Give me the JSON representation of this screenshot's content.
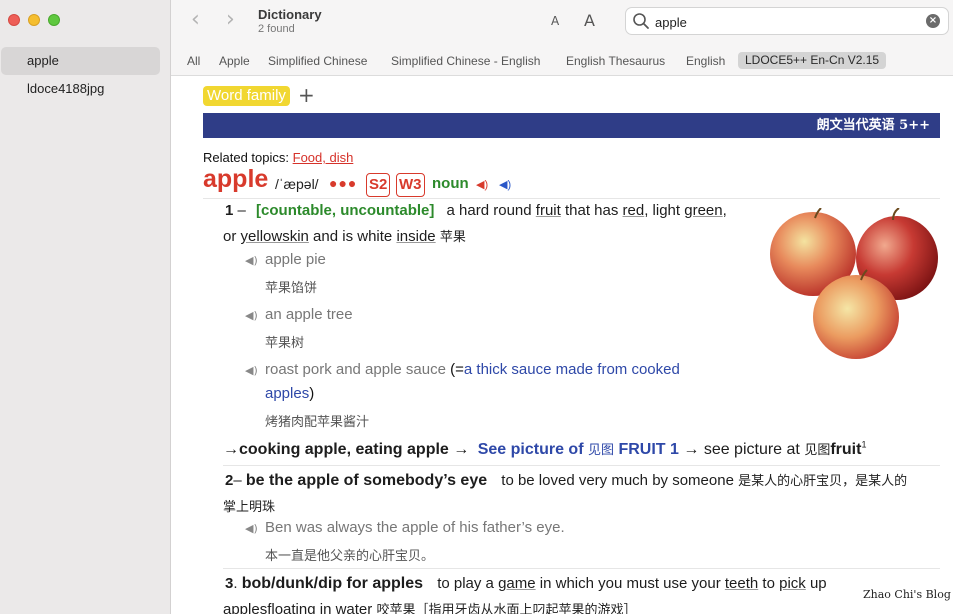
{
  "window": {
    "title": "Dictionary",
    "subtitle": "2 found"
  },
  "toolbar": {
    "font_small": "A",
    "font_large": "A"
  },
  "search": {
    "value": "apple",
    "placeholder": "Search"
  },
  "sidebar": {
    "items": [
      {
        "label": "apple",
        "selected": true
      },
      {
        "label": "ldoce4188jpg",
        "selected": false
      }
    ]
  },
  "tabs": [
    "All",
    "Apple",
    "Simplified Chinese",
    "Simplified Chinese - English",
    "English Thesaurus",
    "English",
    "LDOCE5++ En-Cn V2.15"
  ],
  "selected_tab": "LDOCE5++ En-Cn V2.15",
  "entry": {
    "word_family": "Word family",
    "plus": "+",
    "banner": "朗文当代英语 5++",
    "related_label": "Related topics:",
    "related_link": "Food, dish",
    "headword": "apple",
    "pron": "/ˈæpəl/",
    "freq_dots": "●●●",
    "badge_s": "S2",
    "badge_w": "W3",
    "pos": "noun",
    "sense1": {
      "num": "1",
      "dash": "–",
      "grammar": "[countable, uncountable]",
      "def_a": "a hard round",
      "def_fruit": "fruit",
      "def_b": "that has",
      "def_red": "red",
      "def_c": ", light",
      "def_green": "green",
      "def_d": ",",
      "def_e": "or",
      "def_yellowskin": "yellowskin",
      "def_f": "and is white",
      "def_inside": "inside",
      "cn": "苹果",
      "examples": [
        {
          "en": "apple pie",
          "cn": "苹果馅饼"
        },
        {
          "en": "an apple tree",
          "cn": "苹果树"
        },
        {
          "en": "roast pork and apple sauce",
          "paren_open": "(=",
          "gloss1": "a thick sauce made from cooked",
          "gloss2": "apples",
          "paren_close": ")",
          "cn": "烤猪肉配苹果酱汁"
        }
      ],
      "xref": {
        "arrow1": "→",
        "phrases": "cooking apple, eating apple",
        "arrow2": "→",
        "see_picture": "See picture of",
        "jian": "见图",
        "fruit_caps": "FRUIT 1",
        "arrow3": "→",
        "see_picture2": "see picture at",
        "jian2": "见图",
        "fruit": "fruit",
        "sup": "1"
      }
    },
    "sense2": {
      "num": "2",
      "dash": "–",
      "phrase": "be the apple of somebody’s eye",
      "def": "to be loved very much by someone",
      "cn_a": "是某人的心肝宝贝，是某人的",
      "cn_b": "掌上明珠",
      "example_en": "Ben was always the apple of his father’s eye.",
      "example_cn": "本一直是他父亲的心肝宝贝。"
    },
    "sense3": {
      "num": "3",
      "dot": ".",
      "phrase": "bob/dunk/dip for apples",
      "def_a": "to play a",
      "def_game": "game",
      "def_b": "in which you must use your",
      "def_teeth": "teeth",
      "def_c": "to",
      "def_pick": "pick",
      "def_d": "up",
      "def_line2": "applesfloating in water",
      "cn": "咬苹果［指用牙齿从水面上叼起苹果的游戏］"
    }
  },
  "watermark": "Zhao Chi's Blog",
  "colors": {
    "headword": "#d83a2c",
    "grammar": "#2c8a2b",
    "banner": "#2f3d87",
    "gloss": "#2e48a8",
    "word_family": "#f1d731"
  }
}
